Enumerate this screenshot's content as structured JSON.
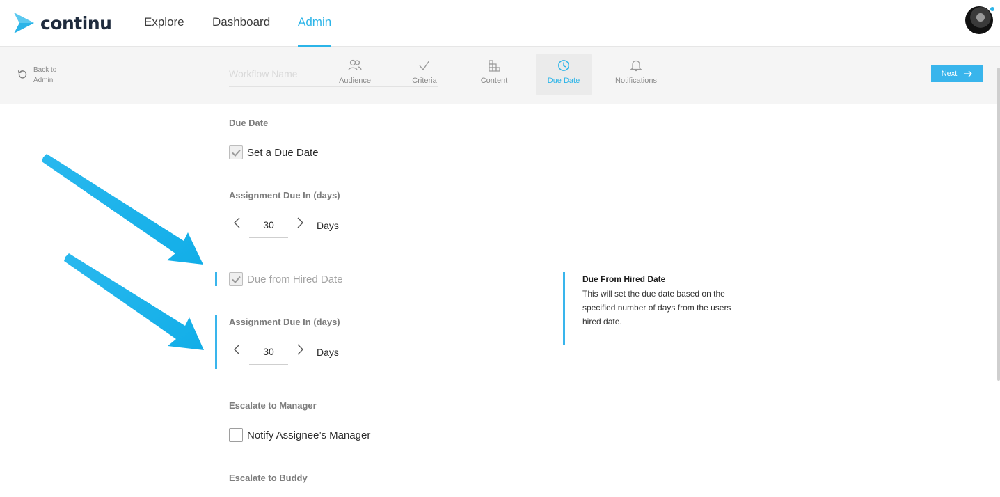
{
  "brand": {
    "name": "continu",
    "accent": "#2bb4e8"
  },
  "nav": {
    "items": [
      {
        "label": "Explore",
        "active": false
      },
      {
        "label": "Dashboard",
        "active": false
      },
      {
        "label": "Admin",
        "active": true
      }
    ]
  },
  "stepbar": {
    "back_label": "Back to Admin",
    "workflow_name_placeholder": "Workflow Name",
    "steps": [
      {
        "label": "Audience",
        "icon": "users-icon",
        "active": false
      },
      {
        "label": "Criteria",
        "icon": "checkmark-icon",
        "active": false
      },
      {
        "label": "Content",
        "icon": "blocks-icon",
        "active": false
      },
      {
        "label": "Due Date",
        "icon": "clock-icon",
        "active": true
      },
      {
        "label": "Notifications",
        "icon": "bell-icon",
        "active": false
      }
    ],
    "next_label": "Next"
  },
  "due_date": {
    "section_label": "Due Date",
    "set_due_date_label": "Set a Due Date",
    "set_due_date_checked": true,
    "assignment_label": "Assignment Due In (days)",
    "assignment_value": "30",
    "days_label": "Days"
  },
  "hired": {
    "label": "Due from Hired Date",
    "checked": true,
    "assignment_label": "Assignment Due In (days)",
    "assignment_value": "30",
    "days_label": "Days"
  },
  "info": {
    "title": "Due From Hired Date",
    "body": "This will set the due date based on the specified number of days from the users hired date."
  },
  "escalate_manager": {
    "section_label": "Escalate to Manager",
    "option_label": "Notify Assignee’s Manager",
    "checked": false
  },
  "escalate_buddy": {
    "section_label": "Escalate to Buddy"
  }
}
